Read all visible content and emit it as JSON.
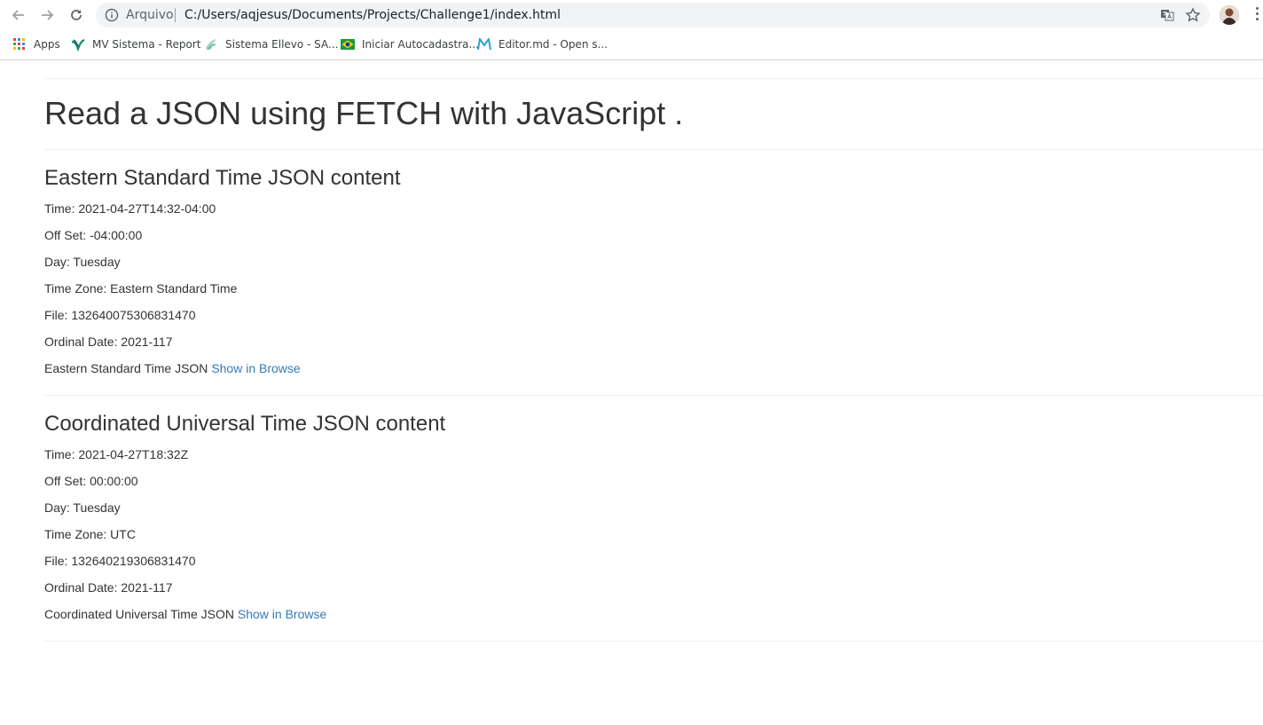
{
  "browser": {
    "omnibox": {
      "security_label": "Arquivo",
      "url": "C:/Users/aqjesus/Documents/Projects/Challenge1/index.html"
    },
    "bookmarks": [
      {
        "label": "Apps"
      },
      {
        "label": "MV Sistema - Report"
      },
      {
        "label": "Sistema Ellevo - SA..."
      },
      {
        "label": "Iniciar Autocadastra..."
      },
      {
        "label": "Editor.md - Open s..."
      }
    ],
    "icons": [
      "back-arrow-icon",
      "forward-arrow-icon",
      "reload-icon",
      "info-icon",
      "translate-icon",
      "star-icon",
      "avatar",
      "menu-dots-icon"
    ]
  },
  "page": {
    "title": "Read a JSON using FETCH with JavaScript .",
    "sections": [
      {
        "heading": "Eastern Standard Time JSON content",
        "fields": [
          "Time: 2021-04-27T14:32-04:00",
          "Off Set: -04:00:00",
          "Day: Tuesday",
          "Time Zone: Eastern Standard Time",
          "File: 132640075306831470",
          "Ordinal Date: 2021-117"
        ],
        "footer_text": "Eastern Standard Time JSON",
        "link_text": "Show in Browse"
      },
      {
        "heading": "Coordinated Universal Time JSON content",
        "fields": [
          "Time: 2021-04-27T18:32Z",
          "Off Set: 00:00:00",
          "Day: Tuesday",
          "Time Zone: UTC",
          "File: 132640219306831470",
          "Ordinal Date: 2021-117"
        ],
        "footer_text": "Coordinated Universal Time JSON",
        "link_text": "Show in Browse"
      }
    ]
  },
  "colors": {
    "text": "#333333",
    "link": "#337ab7",
    "divider": "#eeeeee",
    "omnibox_bg": "#f1f3f4"
  }
}
